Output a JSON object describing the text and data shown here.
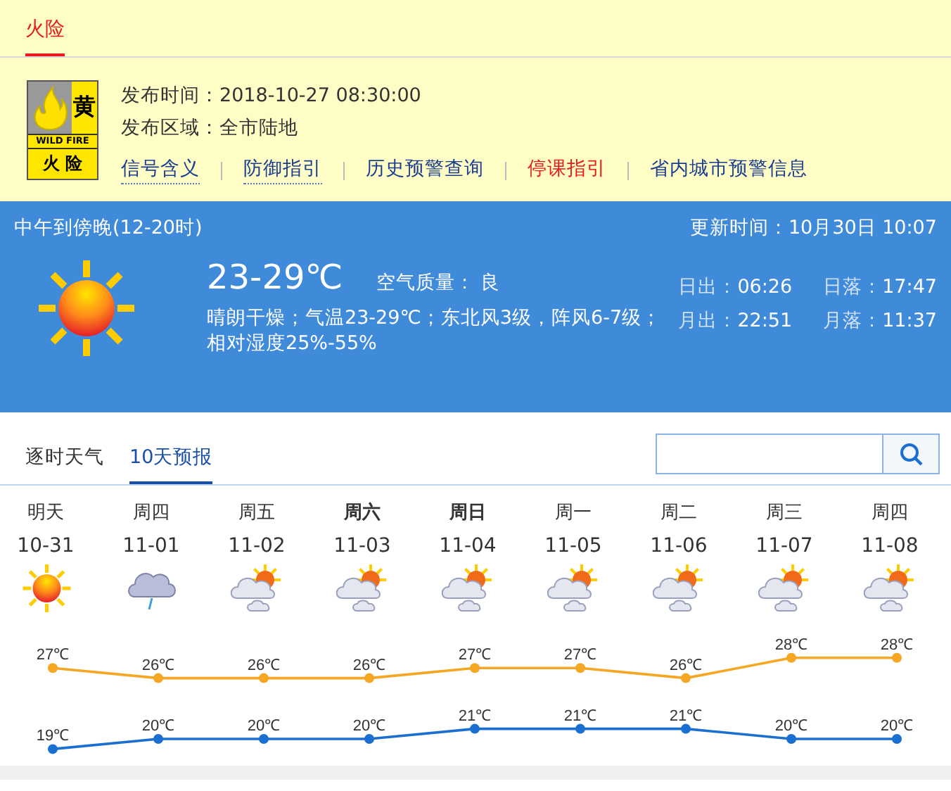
{
  "alert": {
    "tab": "火险",
    "badge": {
      "level_char": "黄",
      "english": "WILD FIRE",
      "type_text": "火 险"
    },
    "fields": [
      {
        "label": "发布时间：",
        "value": "2018-10-27 08:30:00"
      },
      {
        "label": "发布区域：",
        "value": "全市陆地"
      }
    ],
    "links": [
      {
        "label": "信号含义",
        "underlined": true,
        "color": "#1a3d8f"
      },
      {
        "label": "防御指引",
        "underlined": true,
        "color": "#1a3d8f"
      },
      {
        "label": "历史预警查询",
        "underlined": false,
        "color": "#1a3d8f"
      },
      {
        "label": "停课指引",
        "underlined": false,
        "color": "#e8191b"
      },
      {
        "label": "省内城市预警信息",
        "underlined": false,
        "color": "#1a3d8f"
      }
    ]
  },
  "current": {
    "period": "中午到傍晚(12-20时)",
    "updated": "更新时间：10月30日 10:07",
    "temp": "23-29℃",
    "air_label": "空气质量：",
    "air_value": "良",
    "description": "晴朗干燥；气温23-29℃；东北风3级，阵风6-7级；相对湿度25%-55%",
    "astro": [
      {
        "label": "日出：",
        "value": "06:26"
      },
      {
        "label": "日落：",
        "value": "17:47"
      },
      {
        "label": "月出：",
        "value": "22:51"
      },
      {
        "label": "月落：",
        "value": "11:37"
      }
    ]
  },
  "forecast_tabs": [
    {
      "label": "逐时天气",
      "selected": false
    },
    {
      "label": "10天预报",
      "selected": true
    }
  ],
  "days": [
    {
      "weekday": "明天",
      "weekend": false,
      "date": "10-31",
      "kind": "sunny"
    },
    {
      "weekday": "周四",
      "weekend": false,
      "date": "11-01",
      "kind": "rain"
    },
    {
      "weekday": "周五",
      "weekend": false,
      "date": "11-02",
      "kind": "partly-cloudy"
    },
    {
      "weekday": "周六",
      "weekend": true,
      "date": "11-03",
      "kind": "partly-cloudy"
    },
    {
      "weekday": "周日",
      "weekend": true,
      "date": "11-04",
      "kind": "partly-cloudy"
    },
    {
      "weekday": "周一",
      "weekend": false,
      "date": "11-05",
      "kind": "partly-cloudy"
    },
    {
      "weekday": "周二",
      "weekend": false,
      "date": "11-06",
      "kind": "partly-cloudy"
    },
    {
      "weekday": "周三",
      "weekend": false,
      "date": "11-07",
      "kind": "partly-cloudy"
    },
    {
      "weekday": "周四",
      "weekend": false,
      "date": "11-08",
      "kind": "partly-cloudy"
    }
  ],
  "chart_data": {
    "type": "line",
    "series": [
      {
        "color": "#f5a623",
        "marker": true,
        "values": [
          27,
          26,
          26,
          26,
          27,
          27,
          26,
          28,
          28
        ],
        "value_labels": [
          "27℃",
          "26℃",
          "26℃",
          "26℃",
          "27℃",
          "27℃",
          "26℃",
          "28℃",
          "28℃"
        ]
      },
      {
        "color": "#1a6fd1",
        "marker": true,
        "values": [
          19,
          20,
          20,
          20,
          21,
          21,
          21,
          20,
          20
        ],
        "value_labels": [
          "19℃",
          "20℃",
          "20℃",
          "20℃",
          "21℃",
          "21℃",
          "21℃",
          "20℃",
          "20℃"
        ]
      }
    ]
  }
}
